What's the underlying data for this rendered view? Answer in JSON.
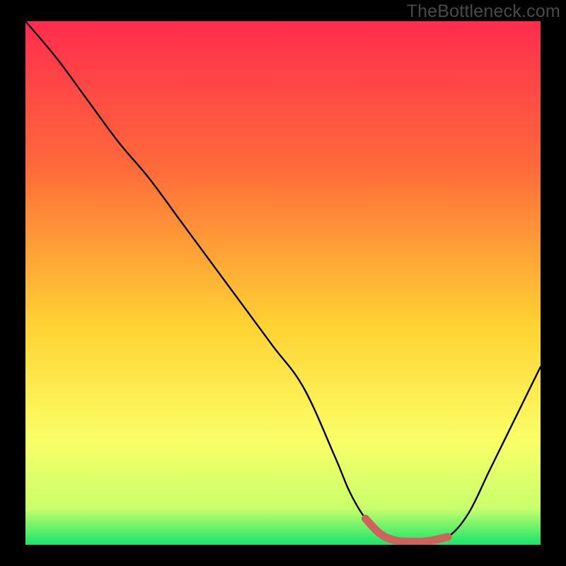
{
  "watermark": "TheBottleneck.com",
  "colors": {
    "frame": "#000000",
    "gradient_top": "#ff2c4f",
    "gradient_mid1": "#ff6a3a",
    "gradient_mid2": "#ffd233",
    "gradient_mid3": "#faff66",
    "gradient_mid4": "#c9ff6b",
    "gradient_bottom": "#17e56a",
    "curve": "#000000",
    "highlight": "#d1615c"
  },
  "chart_data": {
    "type": "line",
    "title": "",
    "xlabel": "",
    "ylabel": "",
    "xlim": [
      0,
      100
    ],
    "ylim": [
      0,
      100
    ],
    "grid": false,
    "x": [
      0,
      6,
      12,
      18,
      24,
      30,
      36,
      42,
      48,
      54,
      60,
      63,
      66,
      69,
      72,
      75,
      78,
      82,
      86,
      90,
      94,
      100
    ],
    "values": [
      100,
      93,
      85,
      77,
      70,
      62,
      54,
      46,
      38,
      30,
      17,
      10,
      5,
      2,
      0.8,
      0.6,
      0.7,
      1.5,
      6,
      14,
      22,
      34
    ],
    "series": [
      {
        "name": "bottleneck-curve",
        "x": [
          0,
          6,
          12,
          18,
          24,
          30,
          36,
          42,
          48,
          54,
          60,
          63,
          66,
          69,
          72,
          75,
          78,
          82,
          86,
          90,
          94,
          100
        ],
        "values": [
          100,
          93,
          85,
          77,
          70,
          62,
          54,
          46,
          38,
          30,
          17,
          10,
          5,
          2,
          0.8,
          0.6,
          0.7,
          1.5,
          6,
          14,
          22,
          34
        ]
      },
      {
        "name": "highlight-segment",
        "x": [
          66,
          69,
          72,
          75,
          78,
          82
        ],
        "values": [
          5,
          2,
          0.8,
          0.6,
          0.7,
          1.5
        ]
      }
    ]
  }
}
